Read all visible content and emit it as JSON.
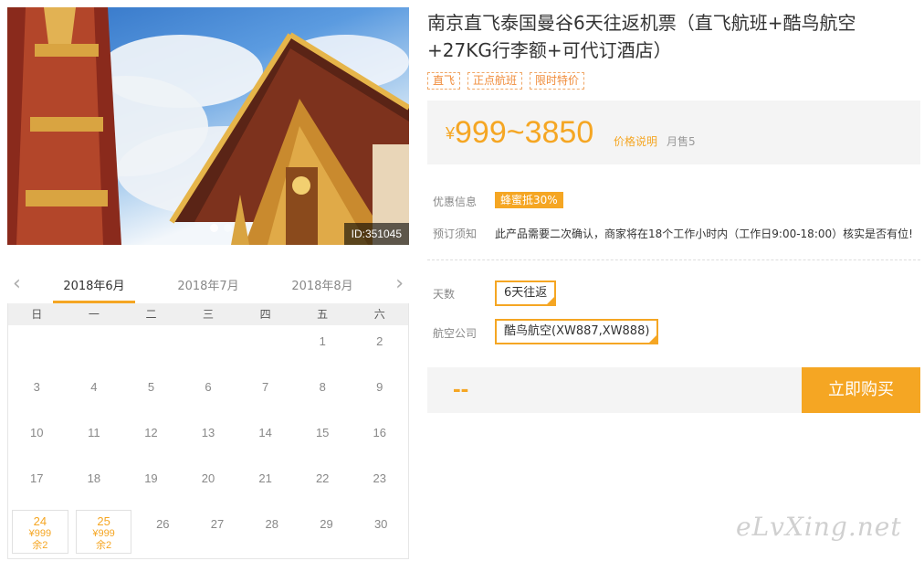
{
  "hero": {
    "id_badge": "ID:351045"
  },
  "calendar": {
    "months": [
      "2018年6月",
      "2018年7月",
      "2018年8月"
    ],
    "weekdays": [
      "日",
      "一",
      "二",
      "三",
      "四",
      "五",
      "六"
    ],
    "rows": [
      [
        "",
        "",
        "",
        "",
        "",
        "1",
        "2"
      ],
      [
        "3",
        "4",
        "5",
        "6",
        "7",
        "8",
        "9"
      ],
      [
        "10",
        "11",
        "12",
        "13",
        "14",
        "15",
        "16"
      ],
      [
        "17",
        "18",
        "19",
        "20",
        "21",
        "22",
        "23"
      ]
    ],
    "last_row": {
      "d24": "24",
      "p24": "¥999",
      "r24": "余2",
      "d25": "25",
      "p25": "¥999",
      "r25": "余2",
      "rest": [
        "26",
        "27",
        "28",
        "29",
        "30"
      ]
    }
  },
  "product": {
    "title": "南京直飞泰国曼谷6天往返机票（直飞航班+酷鸟航空+27KG行李额+可代订酒店）",
    "tags": [
      "直飞",
      "正点航班",
      "限时特价"
    ],
    "price_currency": "¥",
    "price_range": "999~3850",
    "price_note": "价格说明",
    "sold": "月售5",
    "promo_label": "优惠信息",
    "promo_badge": "蜂蜜抵30%",
    "notice_label": "预订须知",
    "notice_text": "此产品需要二次确认，商家将在18个工作小时内（工作日9:00-18:00）核实是否有位!",
    "days_label": "天数",
    "days_value": "6天往返",
    "airline_label": "航空公司",
    "airline_value": "酷鸟航空(XW887,XW888)",
    "total": "--",
    "buy_label": "立即购买"
  },
  "watermark": "eLvXing.net",
  "colors": {
    "accent": "#f5a623",
    "price": "#f5a623"
  }
}
